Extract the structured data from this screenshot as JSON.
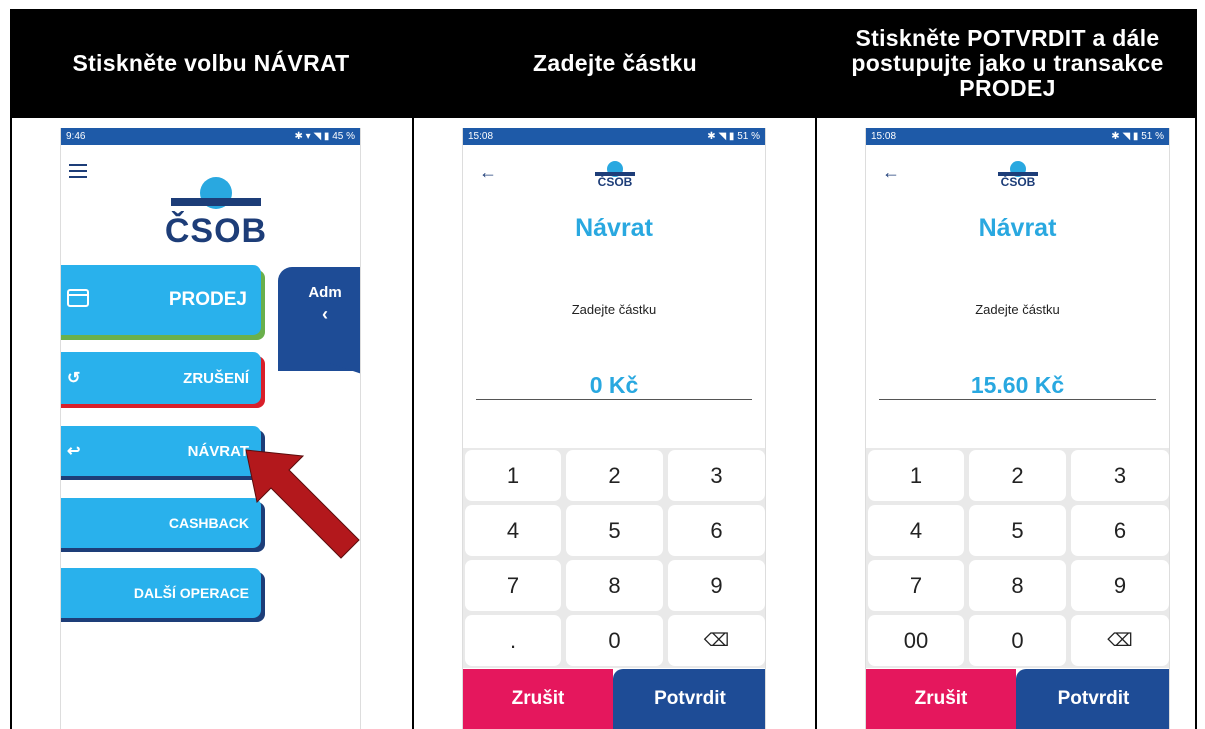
{
  "columns": [
    {
      "heading": "Stiskněte volbu NÁVRAT"
    },
    {
      "heading": "Zadejte částku"
    },
    {
      "heading": "Stiskněte POTVRDIT a dále postupujte jako u transakce PRODEJ"
    }
  ],
  "screen1": {
    "status_time": "9:46",
    "status_icons": "✱ ▾ ◥ ▮ 45 %",
    "logo": "ČSOB",
    "adm_label": "Adm",
    "adm_chevron": "‹",
    "menu": [
      {
        "label": "PRODEJ",
        "icon": "card-icon",
        "glyph": "▭"
      },
      {
        "label": "ZRUŠENÍ",
        "icon": "undo-icon",
        "glyph": "↺"
      },
      {
        "label": "NÁVRAT",
        "icon": "return-icon",
        "glyph": "↩"
      },
      {
        "label": "CASHBACK"
      },
      {
        "label": "DALŠÍ OPERACE"
      }
    ],
    "arrow_color": "#b3181c"
  },
  "screen2": {
    "status_time": "15:08",
    "status_icons": "✱ ◥ ▮ 51 %",
    "back_glyph": "←",
    "logo": "ČSOB",
    "title": "Návrat",
    "subtitle": "Zadejte částku",
    "amount": "0 Kč",
    "keys": [
      "1",
      "2",
      "3",
      "4",
      "5",
      "6",
      "7",
      "8",
      "9",
      ".",
      "0",
      "⌫"
    ],
    "cancel": "Zrušit",
    "confirm": "Potvrdit"
  },
  "screen3": {
    "status_time": "15:08",
    "status_icons": "✱ ◥ ▮ 51 %",
    "back_glyph": "←",
    "logo": "ČSOB",
    "title": "Návrat",
    "subtitle": "Zadejte částku",
    "amount": "15.60 Kč",
    "keys": [
      "1",
      "2",
      "3",
      "4",
      "5",
      "6",
      "7",
      "8",
      "9",
      "00",
      "0",
      "⌫"
    ],
    "cancel": "Zrušit",
    "confirm": "Potvrdit"
  },
  "colors": {
    "accent_blue": "#29b1ec",
    "dark_blue": "#1e4c96",
    "cancel_pink": "#e5175d",
    "prodej_green": "#6ab04c",
    "zruseni_red": "#d9202a"
  }
}
